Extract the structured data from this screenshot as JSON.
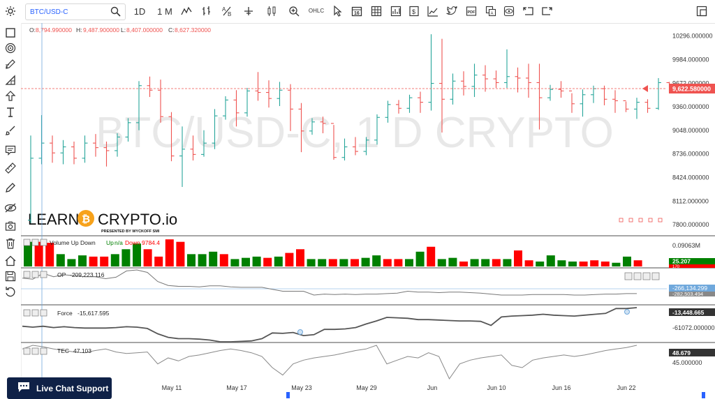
{
  "toolbar": {
    "symbol": "BTC/USD-C",
    "interval_1d": "1D",
    "interval_1m": "1 M",
    "crosshair_label": "OHLC"
  },
  "ohlc": {
    "o_label": "O:",
    "o": "8,794.990000",
    "h_label": "H:",
    "h": "9,487.900000",
    "l_label": "L:",
    "l": "8,407.000000",
    "c_label": "C:",
    "c": "8,627.320000"
  },
  "watermark": "BTC/USD-C, 1 D CRYPTO",
  "logo": {
    "learn": "LEARN",
    "crypto": "CRYPTO.io",
    "tagline": "PRESENTED BY WYCKOFF SMI"
  },
  "price_axis": {
    "labels": [
      "10296.000000",
      "9984.000000",
      "9672.000000",
      "9360.000000",
      "9048.000000",
      "8736.000000",
      "8424.000000",
      "8112.000000",
      "7800.000000"
    ],
    "current": "9,622.580000"
  },
  "panels": {
    "volume": {
      "title": "Volume Up Down",
      "legend_up": "Up",
      "legend_sep": "n/a",
      "legend_down": "Down",
      "legend_value": "9784.4",
      "axis_top": "0.09063M",
      "badge_green": "25.207",
      "badge_red": "170"
    },
    "op": {
      "title": "OP",
      "value": "-209,223.116",
      "badge_blue": "-266,134.299",
      "badge_grey": "-282,503.494"
    },
    "force": {
      "title": "Force",
      "value": "-15,617.595",
      "badge": "-13,448.665",
      "axis_mid": "-61072.000000"
    },
    "tec": {
      "title": "TEC",
      "value": "47.103",
      "badge": "48.679",
      "axis_mid": "45.000000"
    }
  },
  "time_axis": [
    "May 11",
    "May 17",
    "May 23",
    "May 29",
    "Jun",
    "Jun 10",
    "Jun 16",
    "Jun 22"
  ],
  "chat": {
    "label": "Live Chat Support"
  },
  "colors": {
    "up": "#26a69a",
    "down": "#ef5350",
    "vol_up": "#008000",
    "vol_down": "#ff0000",
    "accent": "#2962ff",
    "navy": "#0f2147"
  },
  "chart_data": {
    "type": "ohlc",
    "price_range": [
      7700,
      10450
    ],
    "candles": [
      [
        7860,
        8980,
        7820,
        8680,
        1
      ],
      [
        8680,
        9250,
        8600,
        8880,
        1
      ],
      [
        8880,
        8980,
        8620,
        8750,
        0
      ],
      [
        8750,
        8920,
        8600,
        8830,
        1
      ],
      [
        8830,
        8900,
        8600,
        8680,
        0
      ],
      [
        8680,
        8980,
        8620,
        8880,
        1
      ],
      [
        8880,
        9000,
        8700,
        8820,
        0
      ],
      [
        8820,
        8900,
        8570,
        8780,
        0
      ],
      [
        8780,
        9010,
        8700,
        8960,
        1
      ],
      [
        8960,
        9210,
        8900,
        9150,
        1
      ],
      [
        9150,
        9700,
        9050,
        9640,
        1
      ],
      [
        9640,
        9760,
        9490,
        9580,
        0
      ],
      [
        9580,
        9720,
        9150,
        9230,
        0
      ],
      [
        9230,
        9290,
        8640,
        8710,
        0
      ],
      [
        8710,
        9100,
        8300,
        8800,
        1
      ],
      [
        8800,
        8980,
        8650,
        8730,
        0
      ],
      [
        8730,
        9050,
        8700,
        8880,
        1
      ],
      [
        8880,
        9330,
        8800,
        9240,
        1
      ],
      [
        9240,
        9500,
        9190,
        9450,
        1
      ],
      [
        9450,
        9580,
        9100,
        9280,
        0
      ],
      [
        9280,
        9610,
        9230,
        9570,
        1
      ],
      [
        9570,
        9820,
        9440,
        9550,
        0
      ],
      [
        9550,
        9710,
        9350,
        9470,
        0
      ],
      [
        9470,
        9690,
        9370,
        9580,
        1
      ],
      [
        9580,
        9660,
        9040,
        9330,
        0
      ],
      [
        9330,
        9410,
        8760,
        9040,
        0
      ],
      [
        9040,
        9210,
        8990,
        9160,
        1
      ],
      [
        9160,
        9230,
        9010,
        9140,
        0
      ],
      [
        9140,
        9120,
        8660,
        8690,
        0
      ],
      [
        8690,
        8940,
        8650,
        8830,
        1
      ],
      [
        8830,
        8960,
        8720,
        8770,
        0
      ],
      [
        8770,
        8960,
        8720,
        8920,
        1
      ],
      [
        8920,
        9260,
        8860,
        9220,
        1
      ],
      [
        9220,
        9440,
        9150,
        9390,
        1
      ],
      [
        9390,
        9450,
        9270,
        9340,
        0
      ],
      [
        9340,
        9520,
        9280,
        9480,
        1
      ],
      [
        9480,
        9560,
        9280,
        9420,
        0
      ],
      [
        9420,
        10320,
        9310,
        9670,
        1
      ],
      [
        9670,
        10260,
        9020,
        9460,
        0
      ],
      [
        9460,
        9800,
        9390,
        9700,
        1
      ],
      [
        9700,
        9830,
        9510,
        9630,
        0
      ],
      [
        9630,
        9930,
        9490,
        9780,
        1
      ],
      [
        9780,
        9910,
        9560,
        9730,
        0
      ],
      [
        9730,
        9840,
        9610,
        9680,
        0
      ],
      [
        9680,
        10120,
        9610,
        9760,
        1
      ],
      [
        9760,
        9880,
        9550,
        9740,
        0
      ],
      [
        9740,
        9930,
        9480,
        9680,
        0
      ],
      [
        9680,
        9930,
        9060,
        9480,
        0
      ],
      [
        9480,
        9650,
        9440,
        9590,
        1
      ],
      [
        9590,
        9700,
        9480,
        9570,
        0
      ],
      [
        9570,
        9540,
        9280,
        9400,
        0
      ],
      [
        9400,
        9590,
        9230,
        9520,
        1
      ],
      [
        9520,
        9640,
        9410,
        9600,
        1
      ],
      [
        9600,
        9640,
        9380,
        9460,
        0
      ],
      [
        9460,
        9580,
        9280,
        9440,
        0
      ],
      [
        9440,
        9430,
        9290,
        9330,
        0
      ],
      [
        9330,
        9480,
        9200,
        9420,
        1
      ],
      [
        9420,
        9460,
        9280,
        9340,
        0
      ],
      [
        9340,
        9740,
        9320,
        9680,
        1
      ],
      [
        9680,
        9690,
        9560,
        9622,
        0
      ]
    ],
    "volume_ymax": 0.09063,
    "volume_labels": [
      "Volume Up Down"
    ],
    "volume": [
      [
        0.1,
        1
      ],
      [
        0.1,
        0
      ],
      [
        0.096,
        0
      ],
      [
        0.05,
        1
      ],
      [
        0.03,
        1
      ],
      [
        0.045,
        1
      ],
      [
        0.04,
        0
      ],
      [
        0.04,
        0
      ],
      [
        0.05,
        1
      ],
      [
        0.07,
        1
      ],
      [
        0.093,
        1
      ],
      [
        0.07,
        0
      ],
      [
        0.04,
        0
      ],
      [
        0.11,
        0
      ],
      [
        0.1,
        0
      ],
      [
        0.05,
        1
      ],
      [
        0.05,
        1
      ],
      [
        0.06,
        1
      ],
      [
        0.05,
        0
      ],
      [
        0.03,
        1
      ],
      [
        0.035,
        1
      ],
      [
        0.04,
        1
      ],
      [
        0.035,
        0
      ],
      [
        0.04,
        1
      ],
      [
        0.055,
        0
      ],
      [
        0.07,
        0
      ],
      [
        0.03,
        1
      ],
      [
        0.03,
        1
      ],
      [
        0.03,
        0
      ],
      [
        0.03,
        1
      ],
      [
        0.03,
        0
      ],
      [
        0.035,
        1
      ],
      [
        0.045,
        1
      ],
      [
        0.03,
        0
      ],
      [
        0.03,
        0
      ],
      [
        0.03,
        1
      ],
      [
        0.06,
        1
      ],
      [
        0.08,
        0
      ],
      [
        0.03,
        1
      ],
      [
        0.035,
        1
      ],
      [
        0.02,
        0
      ],
      [
        0.03,
        1
      ],
      [
        0.03,
        1
      ],
      [
        0.03,
        0
      ],
      [
        0.03,
        1
      ],
      [
        0.065,
        0
      ],
      [
        0.025,
        0
      ],
      [
        0.02,
        1
      ],
      [
        0.045,
        1
      ],
      [
        0.025,
        1
      ],
      [
        0.02,
        1
      ],
      [
        0.02,
        0
      ],
      [
        0.025,
        0
      ],
      [
        0.02,
        0
      ],
      [
        0.015,
        1
      ],
      [
        0.04,
        1
      ],
      [
        0.025,
        0
      ]
    ],
    "op": [
      -95,
      -97,
      -85,
      -92,
      -88,
      -90,
      -92,
      -92,
      -96,
      -93,
      -80,
      -78,
      -83,
      -102,
      -110,
      -112,
      -112,
      -113,
      -111,
      -111,
      -113,
      -114,
      -114,
      -114,
      -118,
      -122,
      -122,
      -122,
      -130,
      -128,
      -129,
      -128,
      -129,
      -128,
      -128,
      -127,
      -126,
      -122,
      -124,
      -124,
      -125,
      -124,
      -124,
      -125,
      -126,
      -128,
      -130,
      -130,
      -130,
      -129,
      -129,
      -129,
      -129,
      -130,
      -130,
      -129,
      -128,
      -128,
      -127,
      -127
    ],
    "force": [
      -5,
      -7,
      -5,
      -8,
      -6,
      -8,
      -9,
      -9,
      -9,
      -8,
      -6,
      -7,
      -10,
      -22,
      -30,
      -33,
      -33,
      -34,
      -36,
      -40,
      -40,
      -39,
      -38,
      -33,
      -20,
      -21,
      -19,
      -26,
      -24,
      -12,
      -12,
      -11,
      -8,
      0,
      7,
      15,
      14,
      13,
      10,
      10,
      9,
      8,
      7,
      7,
      6,
      -3,
      16,
      18,
      19,
      20,
      22,
      20,
      19,
      18,
      20,
      22,
      24,
      35,
      35,
      37
    ],
    "tec": [
      50,
      55,
      53,
      50,
      48,
      46,
      45,
      48,
      50,
      46,
      44,
      45,
      46,
      30,
      38,
      34,
      40,
      42,
      45,
      48,
      50,
      48,
      45,
      40,
      25,
      15,
      30,
      35,
      38,
      40,
      42,
      45,
      48,
      50,
      55,
      30,
      35,
      40,
      38,
      45,
      40,
      10,
      30,
      35,
      38,
      40,
      42,
      28,
      25,
      35,
      38,
      40,
      42,
      40,
      42,
      45,
      48,
      50,
      52,
      55
    ]
  }
}
